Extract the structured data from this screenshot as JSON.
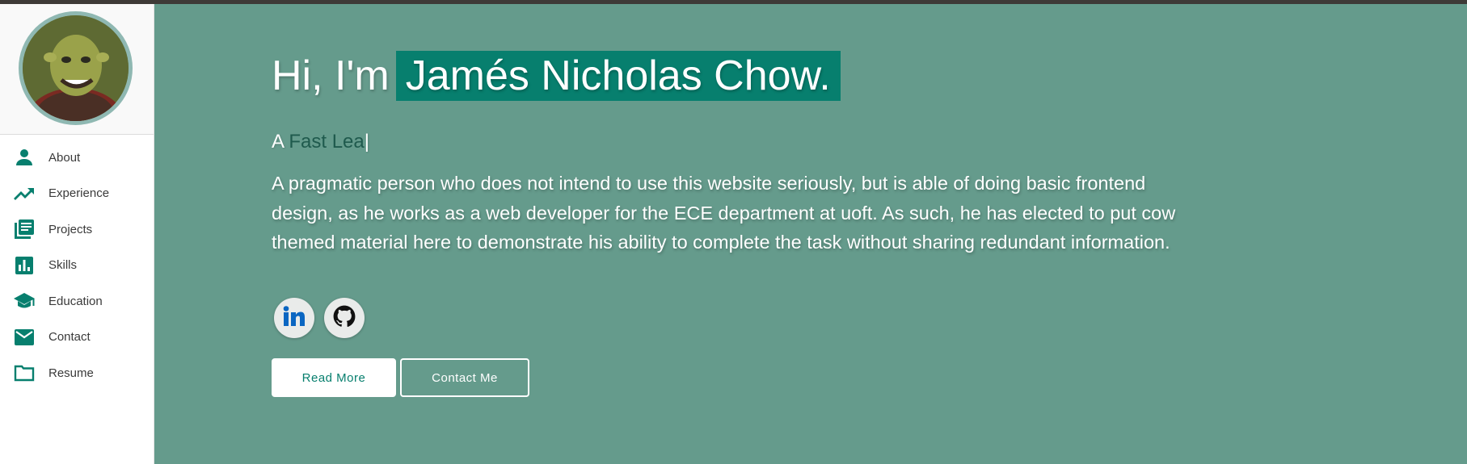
{
  "colors": {
    "accent": "#077f6e",
    "hero_background": "#659b8c",
    "sidebar_background": "#ffffff"
  },
  "sidebar": {
    "items": [
      {
        "label": "About",
        "icon": "person-icon"
      },
      {
        "label": "Experience",
        "icon": "trending-up-icon"
      },
      {
        "label": "Projects",
        "icon": "library-books-icon"
      },
      {
        "label": "Skills",
        "icon": "bar-chart-icon"
      },
      {
        "label": "Education",
        "icon": "graduation-cap-icon"
      },
      {
        "label": "Contact",
        "icon": "email-icon"
      },
      {
        "label": "Resume",
        "icon": "folder-icon"
      }
    ]
  },
  "hero": {
    "greeting_prefix": "Hi, I'm",
    "name": "Jamés Nicholas Chow.",
    "typed_prefix": "A",
    "typed_word": "Fast Lea",
    "typed_cursor": "|",
    "bio": "A pragmatic person who does not intend to use this website seriously, but is able of doing basic frontend design, as he works as a web developer for the ECE department at uoft. As such, he has elected to put cow themed material here to demonstrate his ability to complete the task without sharing redundant information.",
    "social": [
      {
        "icon": "linkedin-icon"
      },
      {
        "icon": "github-icon"
      }
    ],
    "buttons": {
      "read_more": "Read More",
      "contact_me": "Contact Me"
    }
  }
}
